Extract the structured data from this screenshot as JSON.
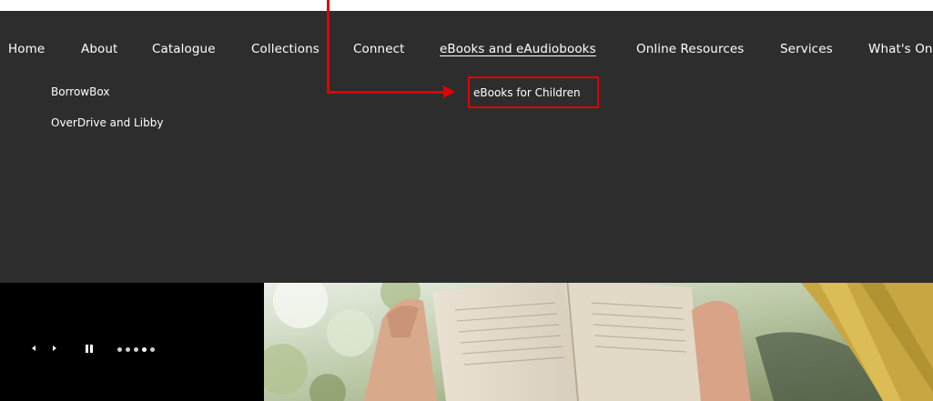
{
  "nav": {
    "items": [
      {
        "label": "Home"
      },
      {
        "label": "About"
      },
      {
        "label": "Catalogue"
      },
      {
        "label": "Collections"
      },
      {
        "label": "Connect"
      },
      {
        "label": "eBooks and eAudiobooks"
      },
      {
        "label": "Online Resources"
      },
      {
        "label": "Services"
      },
      {
        "label": "What's On"
      }
    ],
    "active": "eBooks and eAudiobooks"
  },
  "submenu": {
    "items": [
      {
        "label": "BorrowBox"
      },
      {
        "label": "OverDrive and Libby"
      },
      {
        "label": "eBooks for Children"
      }
    ],
    "highlighted": "eBooks for Children"
  },
  "slider": {
    "prev_icon": "triangle-left",
    "next_icon": "triangle-right",
    "pause_icon": "pause-bars",
    "slide_count": 5,
    "active_slide": 3
  },
  "colors": {
    "menu_background": "#2d2d2d",
    "menu_text": "#ffffff",
    "annotation": "#e00000",
    "slider_background": "#000000"
  }
}
